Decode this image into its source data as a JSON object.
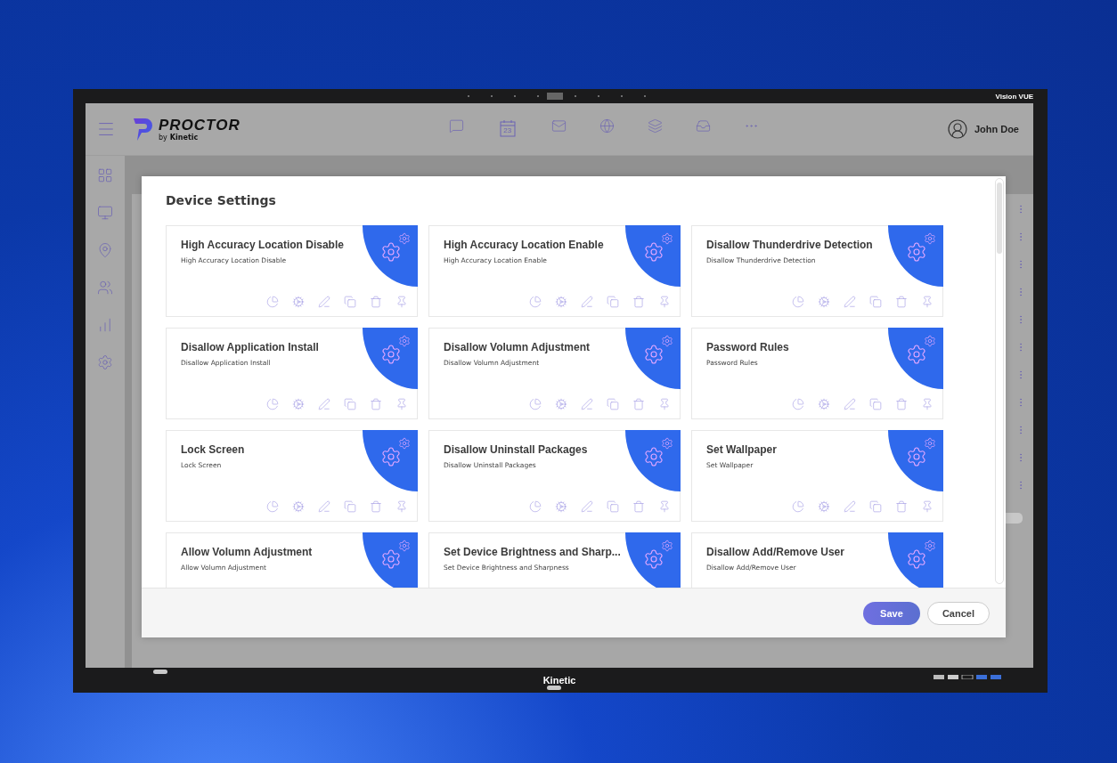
{
  "bezel": {
    "brand": "Vision VUE",
    "logo": "Kinetic"
  },
  "header": {
    "app_name": "PROCTOR",
    "byline": "by",
    "byline_brand": "Kinetic",
    "calendar_day": "23",
    "user": "John Doe"
  },
  "dialog": {
    "title": "Device Settings",
    "cards": [
      {
        "title": "High Accuracy Location Disable",
        "description": "High Accuracy Location Disable"
      },
      {
        "title": "High Accuracy Location Enable",
        "description": "High Accuracy Location Enable"
      },
      {
        "title": "Disallow Thunderdrive Detection",
        "description": "Disallow Thunderdrive Detection"
      },
      {
        "title": "Disallow Application Install",
        "description": "Disallow Application Install"
      },
      {
        "title": "Disallow Volumn Adjustment",
        "description": "Disallow Volumn Adjustment"
      },
      {
        "title": "Password Rules",
        "description": "Password Rules"
      },
      {
        "title": "Lock Screen",
        "description": "Lock Screen"
      },
      {
        "title": "Disallow Uninstall Packages",
        "description": "Disallow Uninstall Packages"
      },
      {
        "title": "Set Wallpaper",
        "description": "Set Wallpaper"
      },
      {
        "title": "Allow Volumn Adjustment",
        "description": "Allow Volumn Adjustment"
      },
      {
        "title": "Set Device Brightness and Sharp...",
        "description": "Set Device Brightness and Sharpness"
      },
      {
        "title": "Disallow Add/Remove User",
        "description": "Disallow Add/Remove User"
      }
    ],
    "buttons": [
      {
        "label": "Save",
        "kind": "primary"
      },
      {
        "label": "Cancel",
        "kind": "secondary"
      }
    ]
  }
}
